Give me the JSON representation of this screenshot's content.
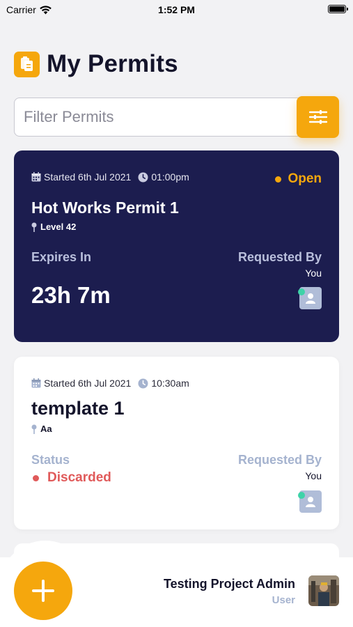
{
  "status_bar": {
    "carrier": "Carrier",
    "time": "1:52 PM"
  },
  "header": {
    "title": "My Permits",
    "icon": "clipboard-icon"
  },
  "filter": {
    "placeholder": "Filter Permits",
    "button_icon": "sliders-icon"
  },
  "permits": [
    {
      "started": "Started 6th Jul 2021",
      "time": "01:00pm",
      "status": "Open",
      "title": "Hot Works Permit 1",
      "location": "Level 42",
      "left_label": "Expires In",
      "left_value": "23h 7m",
      "right_label": "Requested By",
      "requester": "You"
    },
    {
      "started": "Started 6th Jul 2021",
      "time": "10:30am",
      "title": "template 1",
      "location": "Aa",
      "left_label": "Status",
      "status": "Discarded",
      "right_label": "Requested By",
      "requester": "You"
    }
  ],
  "user": {
    "name": "Testing Project Admin",
    "role": "User"
  },
  "colors": {
    "accent": "#f5a70d",
    "card_dark": "#1c1d4f",
    "discarded": "#e05a5a",
    "online": "#3ed3a8"
  }
}
